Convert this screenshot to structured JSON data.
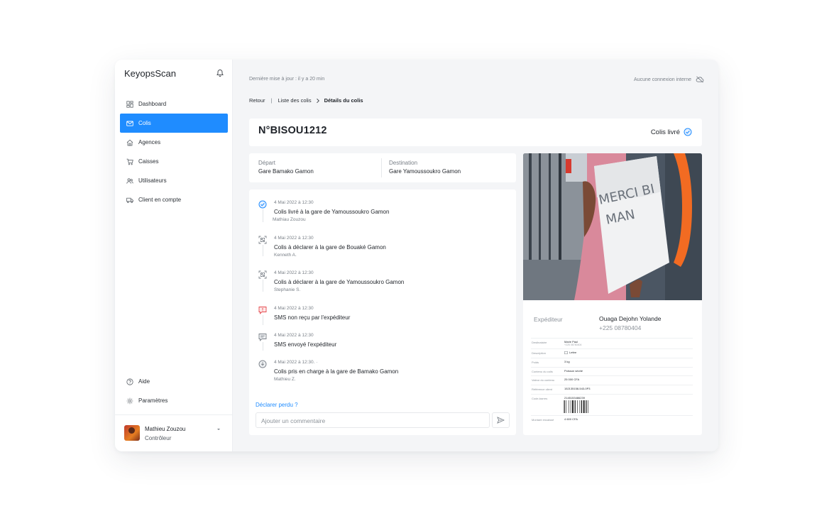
{
  "app": {
    "name": "KeyopsScan"
  },
  "sidebar": {
    "items": [
      {
        "label": "Dashboard",
        "icon": "dashboard-icon",
        "active": false
      },
      {
        "label": "Colis",
        "icon": "mail-icon",
        "active": true
      },
      {
        "label": "Agences",
        "icon": "home-icon",
        "active": false
      },
      {
        "label": "Caisses",
        "icon": "cart-icon",
        "active": false
      },
      {
        "label": "Utilisateurs",
        "icon": "users-icon",
        "active": false
      },
      {
        "label": "Client en compte",
        "icon": "truck-icon",
        "active": false
      }
    ],
    "bottom_items": [
      {
        "label": "Aide",
        "icon": "help-icon"
      },
      {
        "label": "Paramètres",
        "icon": "gear-icon"
      }
    ],
    "user": {
      "name": "Mathieu Zouzou",
      "role": "Contrôleur"
    }
  },
  "topbar": {
    "last_update": "Dernière mise à jour : il y a 20 min",
    "connection": "Aucune connexion interne"
  },
  "breadcrumb": {
    "back": "Retour",
    "list": "Liste des colis",
    "current": "Détails du colis"
  },
  "parcel": {
    "number": "N°BISOU1212",
    "status": "Colis livré"
  },
  "route": {
    "departure_label": "Départ",
    "departure": "Gare Bamako Gamon",
    "destination_label": "Destination",
    "destination": "Gare Yamoussoukro Gamon"
  },
  "timeline": [
    {
      "time": "4 Mai 2022 à 12:30",
      "message": "Colis livré à la gare de Yamoussoukro Gamon",
      "author": "Mathiau Zouzou",
      "icon": "check-circle-icon"
    },
    {
      "time": "4 Mai 2022 à 12:30",
      "message": "Colis à déclarer à la gare de Bouaké Gamon",
      "author": "Kenneth A.",
      "icon": "scan-icon"
    },
    {
      "time": "4 Mai 2022 à 12:30",
      "message": "Colis à déclarer à la gare de Yamoussoukro Gamon",
      "author": "Stephanie S.",
      "icon": "scan-icon"
    },
    {
      "time": "4 Mai 2022 à 12:30",
      "message": "SMS non reçu par l'expéditeur",
      "author": "",
      "icon": "sms-error-icon"
    },
    {
      "time": "4 Mai 2022 à 12:30",
      "message": "SMS envoyé l'expéditeur",
      "author": "",
      "icon": "sms-icon"
    },
    {
      "time": "4 Mai 2022 à 12:30. ·",
      "message": "Colis pris en charge à la gare de Bamako Gamon",
      "author": "Mathieu Z.",
      "icon": "download-icon"
    }
  ],
  "actions": {
    "declare_lost": "Déclarer perdu ?",
    "comment_placeholder": "Ajouter un commentaire"
  },
  "sender": {
    "label": "Expéditeur",
    "name": "Ouaga Dejohn Yolande",
    "phone": "+225 08780404"
  },
  "details": [
    {
      "key": "Destinataire",
      "value": "Marie Paul",
      "sub": "+225 08780404"
    },
    {
      "key": "Description",
      "value": "Lettre"
    },
    {
      "key": "Poids",
      "value": "3 kg"
    },
    {
      "key": "Contenu du colis",
      "value": "Poisson séché"
    },
    {
      "key": "Valeur du contenu",
      "value": "25 000 CFA"
    },
    {
      "key": "Référence client",
      "value": "152135158-543-0P3"
    },
    {
      "key": "Code-barres",
      "value": "2145153486239"
    },
    {
      "key": "Montant encaissé",
      "value": "4 600 CFA"
    }
  ],
  "colors": {
    "accent": "#1f8cff",
    "error": "#e5484d",
    "photo_orange": "#f26b22"
  }
}
